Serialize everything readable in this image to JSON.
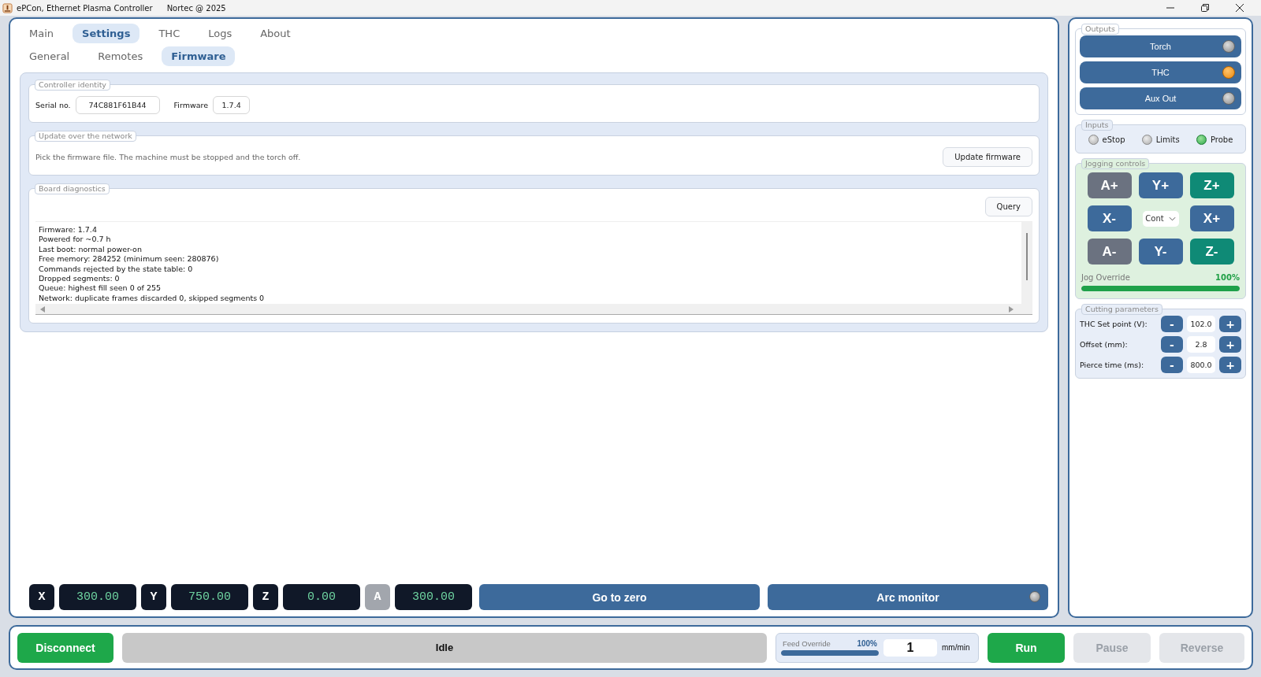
{
  "window": {
    "title": "ePCon, Ethernet Plasma Controller",
    "subtitle": "Nortec @ 2025"
  },
  "tabs": [
    {
      "label": "Main",
      "selected": false
    },
    {
      "label": "Settings",
      "selected": true
    },
    {
      "label": "THC",
      "selected": false
    },
    {
      "label": "Logs",
      "selected": false
    },
    {
      "label": "About",
      "selected": false
    }
  ],
  "subtabs": [
    {
      "label": "General",
      "selected": false
    },
    {
      "label": "Remotes",
      "selected": false
    },
    {
      "label": "Firmware",
      "selected": true
    }
  ],
  "identity": {
    "legend": "Controller identity",
    "serial_label": "Serial no.",
    "serial": "74C881F61B44",
    "firmware_label": "Firmware",
    "firmware": "1.7.4"
  },
  "update": {
    "legend": "Update over the network",
    "hint": "Pick the firmware file. The machine must be stopped and the torch off.",
    "button": "Update firmware"
  },
  "diagnostics": {
    "legend": "Board diagnostics",
    "button": "Query",
    "lines": [
      "Firmware: 1.7.4",
      "Powered for ~0.7 h",
      "Last boot: normal power-on",
      "Free memory: 284252 (minimum seen: 280876)",
      "Commands rejected by the state table: 0",
      "Dropped segments: 0",
      "Queue: highest fill seen 0 of 255",
      "Network: duplicate frames discarded 0, skipped segments 0"
    ]
  },
  "dro": [
    {
      "axis": "X",
      "value": "300.00",
      "disabled": false
    },
    {
      "axis": "Y",
      "value": "750.00",
      "disabled": false
    },
    {
      "axis": "Z",
      "value": "0.00",
      "disabled": false
    },
    {
      "axis": "A",
      "value": "300.00",
      "disabled": true
    }
  ],
  "go_to_zero": "Go to zero",
  "arc_monitor": {
    "label": "Arc monitor",
    "on": false
  },
  "outputs": {
    "legend": "Outputs",
    "items": [
      {
        "label": "Torch",
        "on": false
      },
      {
        "label": "THC",
        "on": true
      },
      {
        "label": "Aux Out",
        "on": false
      }
    ]
  },
  "inputs": {
    "legend": "Inputs",
    "items": [
      {
        "label": "eStop",
        "on": false
      },
      {
        "label": "Limits",
        "on": false
      },
      {
        "label": "Probe",
        "on": true
      }
    ]
  },
  "jogging": {
    "legend": "Jogging controls",
    "buttons": [
      {
        "label": "A+",
        "color": "#6b7280"
      },
      {
        "label": "Y+",
        "color": "#3d6a9b"
      },
      {
        "label": "Z+",
        "color": "#0f8a76"
      },
      {
        "label": "X-",
        "color": "#3d6a9b"
      },
      {
        "kind": "select",
        "label": "Cont"
      },
      {
        "label": "X+",
        "color": "#3d6a9b"
      },
      {
        "label": "A-",
        "color": "#6b7280"
      },
      {
        "label": "Y-",
        "color": "#3d6a9b"
      },
      {
        "label": "Z-",
        "color": "#0f8a76"
      }
    ],
    "override_label": "Jog Override",
    "override_reading": "100%",
    "level": 1
  },
  "cutting": {
    "legend": "Cutting parameters",
    "rows": [
      {
        "label": "THC Set point (V):",
        "value": "102.0",
        "minus": "-",
        "plus": "+"
      },
      {
        "label": "Offset (mm):",
        "value": "2.8",
        "minus": "-",
        "plus": "+"
      },
      {
        "label": "Pierce time (ms):",
        "value": "800.0",
        "minus": "-",
        "plus": "+"
      }
    ]
  },
  "bottom": {
    "disconnect": "Disconnect",
    "status": "Idle",
    "feed_label": "Feed Override",
    "feed_reading": "100%",
    "level": 1,
    "feed_value": "1",
    "feed_unit": "mm/min",
    "buttons": [
      {
        "label": "Run",
        "disabled": false
      },
      {
        "label": "Pause",
        "disabled": true
      },
      {
        "label": "Reverse",
        "disabled": true
      }
    ]
  }
}
